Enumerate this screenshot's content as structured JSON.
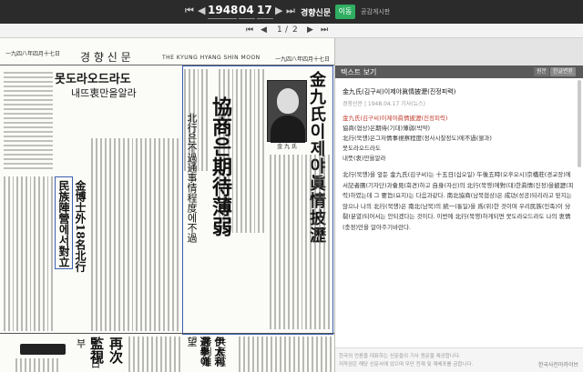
{
  "topbar": {
    "first_icon": "⏮",
    "prev_icon": "◀",
    "year": "1948",
    "month": "04",
    "day": "17",
    "next_icon": "▶",
    "last_icon": "⏭",
    "newspaper": "경향신문",
    "go_label": "이동",
    "publication_label": "공감게시판"
  },
  "pager": {
    "first_icon": "⏮",
    "prev_icon": "◀",
    "current": "1",
    "total": "2",
    "next_icon": "▶",
    "last_icon": "⏭",
    "separator": "/"
  },
  "paper": {
    "masthead_left": "一九四八年四月十七日",
    "masthead_title": "경 향 신 문",
    "masthead_eng": "THE KYUNG HYANG SHIN MOON",
    "masthead_right": "一九四八年四月十七日",
    "headline_main": "金九氏이제야眞情披瀝",
    "headline_sub": "協商은期待薄弱",
    "headline_sub2": "北行은不過通事情程度에不過",
    "banner_top": "못도라오드라도",
    "banner_top2": "내뜨衷만을알라",
    "side_headline": "民族陣營에서對立",
    "side_headline2": "金博士外18名北行",
    "lower_headline": "再次監視",
    "lower_sub": "十九日부",
    "lower_mid": "伊太利選擧에",
    "lower_mid2": "共產黨勝利難望",
    "photo_caption": "金 九 氏"
  },
  "panel": {
    "title": "텍스트 보기",
    "btn_original": "원문",
    "btn_korean": "한글변환",
    "article_title": "金九氏(김구씨)이제야眞情披瀝(진정피력)",
    "article_date": "경향신문 | 1948.04.17 기사(뉴스)",
    "line1": "金九氏(김구씨)이제야眞情披瀝(진정피력)",
    "line2": "協商(협상)은期待(기대)薄弱(박약)",
    "line3": "北行(북행)은그저情事視察程度(정사시찰정도)에不過(불과)",
    "line4": "못도라오드라도",
    "line5": "내뜻(衷)만을알라",
    "para": "北行(북행)을 앞둔 金九氏(김구씨)는 十五日(십오일) 午後五時(오후오시)京橋莊(경교장)에서記者團(기자단)과會見(회견)하고 自身(자신)의 北行(북행)에對(대)한眞情(진정)을披瀝(피력)하였는데 그 要旨(요지)는 다음과같다. 南北協商(남북협상)은 成功(성공)되리라고 믿지는 않으나 나의 北行(북행)은 南北(남북)의 統一(통일)을 爲(위)한 것이며 우리民族(민족)이 分裂(분열)되어서는 안되겠다는 것이다. 이번에 北行(북행)하게되면 못도라오드라도 나의 衷情(충정)만을 알아주기바란다."
  },
  "footer": {
    "line1": "한국의 언론을 대표하는 신문들의 기사 원문을 제공합니다.",
    "line2": "저작권은 해당 신문사에 있으며 무단 전재 및 재배포를 금합니다.",
    "right": "한국사진아카이브"
  }
}
